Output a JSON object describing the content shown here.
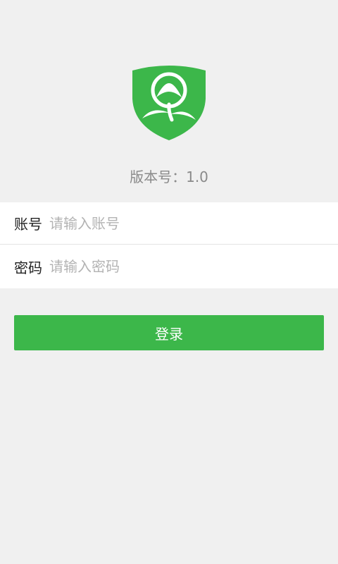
{
  "app": {
    "logo_icon": "shield-plant-logo",
    "accent_color": "#3cb74a"
  },
  "version": {
    "text": "版本号：1.0"
  },
  "form": {
    "account": {
      "label": "账号",
      "placeholder": "请输入账号",
      "value": ""
    },
    "password": {
      "label": "密码",
      "placeholder": "请输入密码",
      "value": ""
    }
  },
  "login_button": {
    "label": "登录"
  }
}
